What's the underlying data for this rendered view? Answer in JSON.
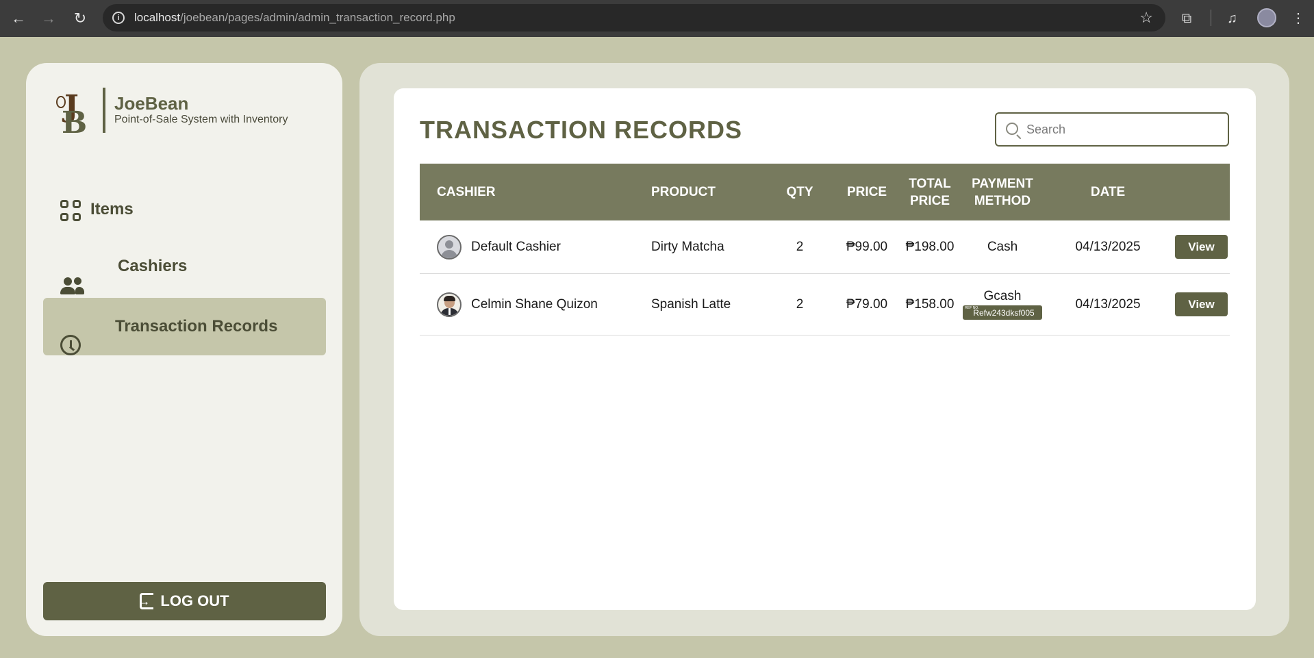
{
  "browser": {
    "url_host": "localhost",
    "url_path": "/joebean/pages/admin/admin_transaction_record.php"
  },
  "sidebar": {
    "brand_name": "JoeBean",
    "brand_subtitle": "Point-of-Sale System with Inventory",
    "items": [
      {
        "label": "Items",
        "icon": "grid-icon",
        "active": false
      },
      {
        "label": "Cashiers",
        "icon": "users-icon",
        "active": false
      },
      {
        "label": "Transaction Records",
        "icon": "clock-icon",
        "active": true
      }
    ],
    "logout_label": "LOG OUT"
  },
  "main": {
    "title": "TRANSACTION RECORDS",
    "search_placeholder": "Search",
    "columns": [
      "CASHIER",
      "PRODUCT",
      "QTY",
      "PRICE",
      "TOTAL PRICE",
      "PAYMENT METHOD",
      "DATE"
    ],
    "rows": [
      {
        "cashier": "Default Cashier",
        "product": "Dirty Matcha",
        "qty": "2",
        "price": "₱99.00",
        "total": "₱198.00",
        "payment": "Cash",
        "ref_label": "",
        "ref": "",
        "date": "04/13/2025",
        "action": "View"
      },
      {
        "cashier": "Celmin Shane Quizon",
        "product": "Spanish Latte",
        "qty": "2",
        "price": "₱79.00",
        "total": "₱158.00",
        "payment": "Gcash",
        "ref_label": "REF NO.",
        "ref": "Refw243dksf005",
        "date": "04/13/2025",
        "action": "View"
      }
    ]
  },
  "colors": {
    "accent": "#5f6244",
    "header_bg": "#777a5e",
    "page_bg": "#c5c6aa"
  }
}
